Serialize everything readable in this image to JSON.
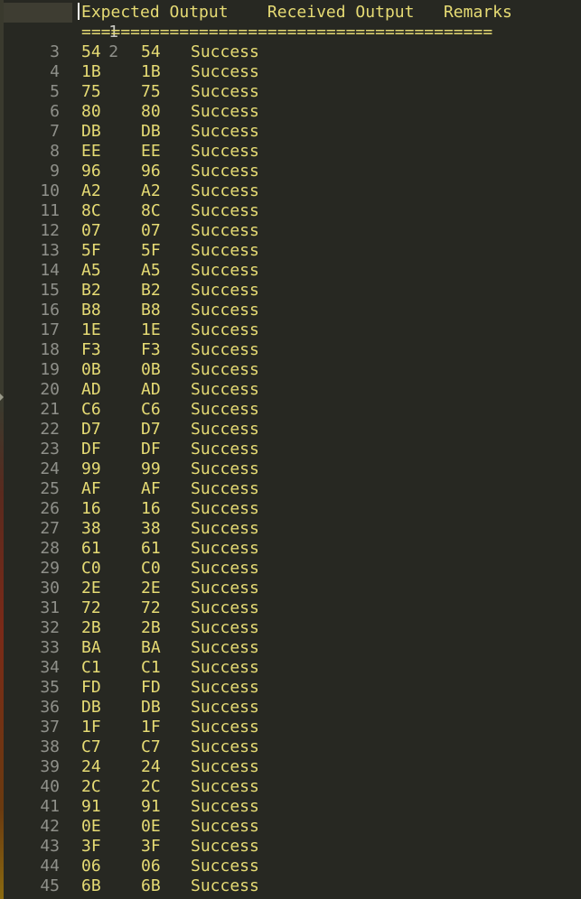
{
  "editor": {
    "header_line": "Expected Output    Received Output   Remarks",
    "separator_line": "==========================================",
    "line_numbers": [
      "1",
      "2",
      "3",
      "4",
      "5",
      "6",
      "7",
      "8",
      "9",
      "10",
      "11",
      "12",
      "13",
      "14",
      "15",
      "16",
      "17",
      "18",
      "19",
      "20",
      "21",
      "22",
      "23",
      "24",
      "25",
      "26",
      "27",
      "28",
      "29",
      "30",
      "31",
      "32",
      "33",
      "34",
      "35",
      "36",
      "37",
      "38",
      "39",
      "40",
      "41",
      "42",
      "43",
      "44",
      "45"
    ],
    "rows": [
      {
        "expected": "54",
        "received": "54",
        "remark": "Success"
      },
      {
        "expected": "1B",
        "received": "1B",
        "remark": "Success"
      },
      {
        "expected": "75",
        "received": "75",
        "remark": "Success"
      },
      {
        "expected": "80",
        "received": "80",
        "remark": "Success"
      },
      {
        "expected": "DB",
        "received": "DB",
        "remark": "Success"
      },
      {
        "expected": "EE",
        "received": "EE",
        "remark": "Success"
      },
      {
        "expected": "96",
        "received": "96",
        "remark": "Success"
      },
      {
        "expected": "A2",
        "received": "A2",
        "remark": "Success"
      },
      {
        "expected": "8C",
        "received": "8C",
        "remark": "Success"
      },
      {
        "expected": "07",
        "received": "07",
        "remark": "Success"
      },
      {
        "expected": "5F",
        "received": "5F",
        "remark": "Success"
      },
      {
        "expected": "A5",
        "received": "A5",
        "remark": "Success"
      },
      {
        "expected": "B2",
        "received": "B2",
        "remark": "Success"
      },
      {
        "expected": "B8",
        "received": "B8",
        "remark": "Success"
      },
      {
        "expected": "1E",
        "received": "1E",
        "remark": "Success"
      },
      {
        "expected": "F3",
        "received": "F3",
        "remark": "Success"
      },
      {
        "expected": "0B",
        "received": "0B",
        "remark": "Success"
      },
      {
        "expected": "AD",
        "received": "AD",
        "remark": "Success"
      },
      {
        "expected": "C6",
        "received": "C6",
        "remark": "Success"
      },
      {
        "expected": "D7",
        "received": "D7",
        "remark": "Success"
      },
      {
        "expected": "DF",
        "received": "DF",
        "remark": "Success"
      },
      {
        "expected": "99",
        "received": "99",
        "remark": "Success"
      },
      {
        "expected": "AF",
        "received": "AF",
        "remark": "Success"
      },
      {
        "expected": "16",
        "received": "16",
        "remark": "Success"
      },
      {
        "expected": "38",
        "received": "38",
        "remark": "Success"
      },
      {
        "expected": "61",
        "received": "61",
        "remark": "Success"
      },
      {
        "expected": "C0",
        "received": "C0",
        "remark": "Success"
      },
      {
        "expected": "2E",
        "received": "2E",
        "remark": "Success"
      },
      {
        "expected": "72",
        "received": "72",
        "remark": "Success"
      },
      {
        "expected": "2B",
        "received": "2B",
        "remark": "Success"
      },
      {
        "expected": "BA",
        "received": "BA",
        "remark": "Success"
      },
      {
        "expected": "C1",
        "received": "C1",
        "remark": "Success"
      },
      {
        "expected": "FD",
        "received": "FD",
        "remark": "Success"
      },
      {
        "expected": "DB",
        "received": "DB",
        "remark": "Success"
      },
      {
        "expected": "1F",
        "received": "1F",
        "remark": "Success"
      },
      {
        "expected": "C7",
        "received": "C7",
        "remark": "Success"
      },
      {
        "expected": "24",
        "received": "24",
        "remark": "Success"
      },
      {
        "expected": "2C",
        "received": "2C",
        "remark": "Success"
      },
      {
        "expected": "91",
        "received": "91",
        "remark": "Success"
      },
      {
        "expected": "0E",
        "received": "0E",
        "remark": "Success"
      },
      {
        "expected": "3F",
        "received": "3F",
        "remark": "Success"
      },
      {
        "expected": "06",
        "received": "06",
        "remark": "Success"
      },
      {
        "expected": "6B",
        "received": "6B",
        "remark": "Success"
      }
    ]
  },
  "colors": {
    "background": "#272822",
    "text": "#e6db74",
    "line_number": "#8f908a",
    "active_line": "#3e3d32"
  }
}
